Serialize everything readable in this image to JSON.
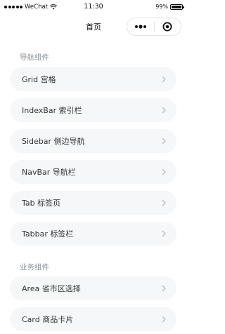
{
  "status_bar": {
    "carrier": "WeChat",
    "time": "11:30",
    "battery": "99%",
    "battery_level": 0.99
  },
  "nav": {
    "title": "首页"
  },
  "sections": [
    {
      "title": "导航组件",
      "items": [
        {
          "label": "Grid 宫格"
        },
        {
          "label": "IndexBar 索引栏"
        },
        {
          "label": "Sidebar 侧边导航"
        },
        {
          "label": "NavBar 导航栏"
        },
        {
          "label": "Tab 标签页"
        },
        {
          "label": "Tabbar 标签栏"
        }
      ]
    },
    {
      "title": "业务组件",
      "items": [
        {
          "label": "Area 省市区选择"
        },
        {
          "label": "Card 商品卡片"
        }
      ]
    }
  ],
  "icons": {
    "chevron": "chevron-right-icon",
    "more": "more-dots-icon",
    "close": "target-close-icon"
  },
  "colors": {
    "item_bg": "#f6f7f9",
    "section_title": "#8a8f99",
    "chevron": "#b8bcc4"
  }
}
